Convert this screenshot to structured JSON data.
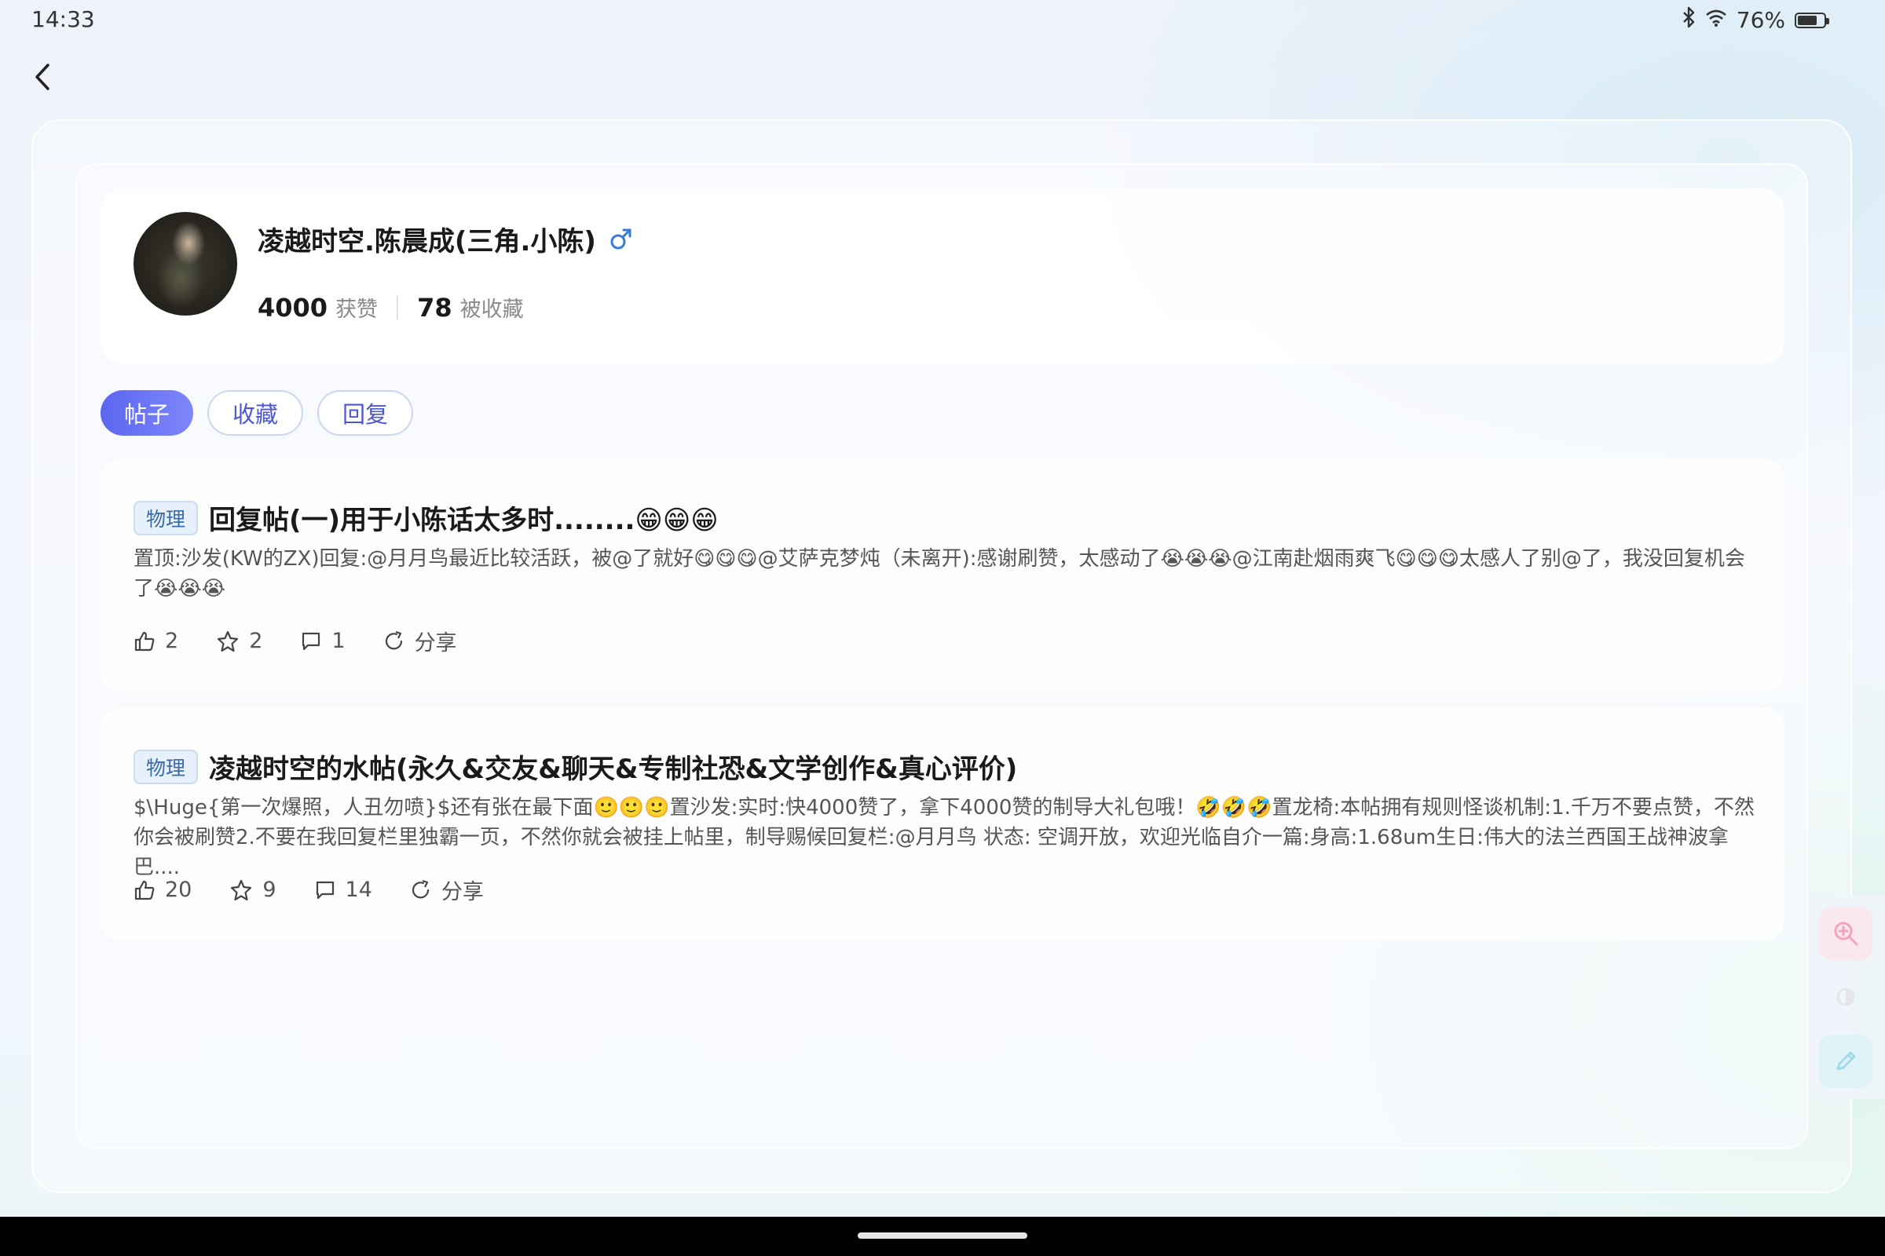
{
  "status_bar": {
    "time": "14:33",
    "battery": "76%",
    "battery_level": 0.76,
    "icons": [
      "bluetooth-icon",
      "wifi-icon",
      "battery-icon"
    ]
  },
  "profile": {
    "name": "凌越时空.陈晨成(三角.小陈)",
    "gender_icon": "male-icon",
    "likes_count": "4000",
    "likes_label": "获赞",
    "favorites_count": "78",
    "favorites_label": "被收藏"
  },
  "tabs": [
    {
      "label": "帖子",
      "active": true
    },
    {
      "label": "收藏",
      "active": false
    },
    {
      "label": "回复",
      "active": false
    }
  ],
  "posts": [
    {
      "tag": "物理",
      "title": "回复帖(一)用于小陈话太多时........😁😁😁",
      "body": "置顶:沙发(KW的ZX)回复:@月月鸟最近比较活跃，被@了就好😋😋😋@艾萨克梦炖（未离开):感谢刷赞，太感动了😭😭😭@江南赴烟雨爽飞😋😋😋太感人了别@了，我没回复机会了😭😭😭",
      "likes": "2",
      "favorites": "2",
      "comments": "1",
      "share": "分享"
    },
    {
      "tag": "物理",
      "title": "凌越时空的水帖(永久&交友&聊天&专制社恐&文学创作&真心评价)",
      "body": "$\\Huge{第一次爆照，人丑勿喷}$还有张在最下面🙂🙂🙂置沙发:实时:快4000赞了，拿下4000赞的制导大礼包哦！🤣🤣🤣置龙椅:本帖拥有规则怪谈机制:1.千万不要点赞，不然你会被刷赞2.不要在我回复栏里独霸一页，不然你就会被挂上帖里，制导赐候回复栏:@月月鸟 状态: 空调开放，欢迎光临自介一篇:身高:1.68um生日:伟大的法兰西国王战神波拿巴....",
      "likes": "20",
      "favorites": "9",
      "comments": "14",
      "share": "分享"
    }
  ],
  "floating_tools": [
    "zoom-in-icon",
    "contrast-icon",
    "pencil-icon"
  ],
  "colors": {
    "accent": "#5c66f0",
    "tag_text": "#3a6aa8",
    "male": "#3a7bd5"
  }
}
